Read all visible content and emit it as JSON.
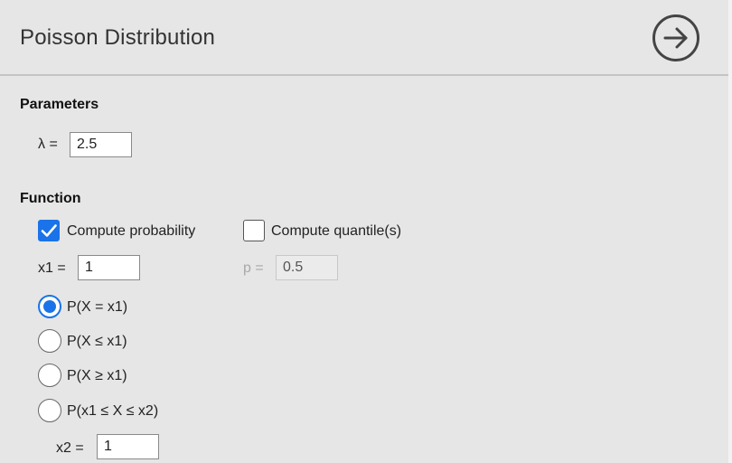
{
  "header": {
    "title": "Poisson Distribution",
    "action_icon": "arrow-right-circle-icon"
  },
  "parameters": {
    "section_label": "Parameters",
    "lambda_label": "λ =",
    "lambda_value": "2.5"
  },
  "function": {
    "section_label": "Function",
    "compute_probability": {
      "label": "Compute probability",
      "checked": true
    },
    "compute_quantile": {
      "label": "Compute quantile(s)",
      "checked": false
    },
    "x1_label": "x1 =",
    "x1_value": "1",
    "p_label": "p =",
    "p_value": "0.5",
    "options": [
      {
        "label": "P(X = x1)",
        "selected": true
      },
      {
        "label": "P(X ≤ x1)",
        "selected": false
      },
      {
        "label": "P(X ≥ x1)",
        "selected": false
      },
      {
        "label": "P(x1 ≤ X ≤ x2)",
        "selected": false
      }
    ],
    "x2_label": "x2 =",
    "x2_value": "1"
  },
  "colors": {
    "accent": "#1a73e8",
    "background": "#e6e6e6"
  }
}
